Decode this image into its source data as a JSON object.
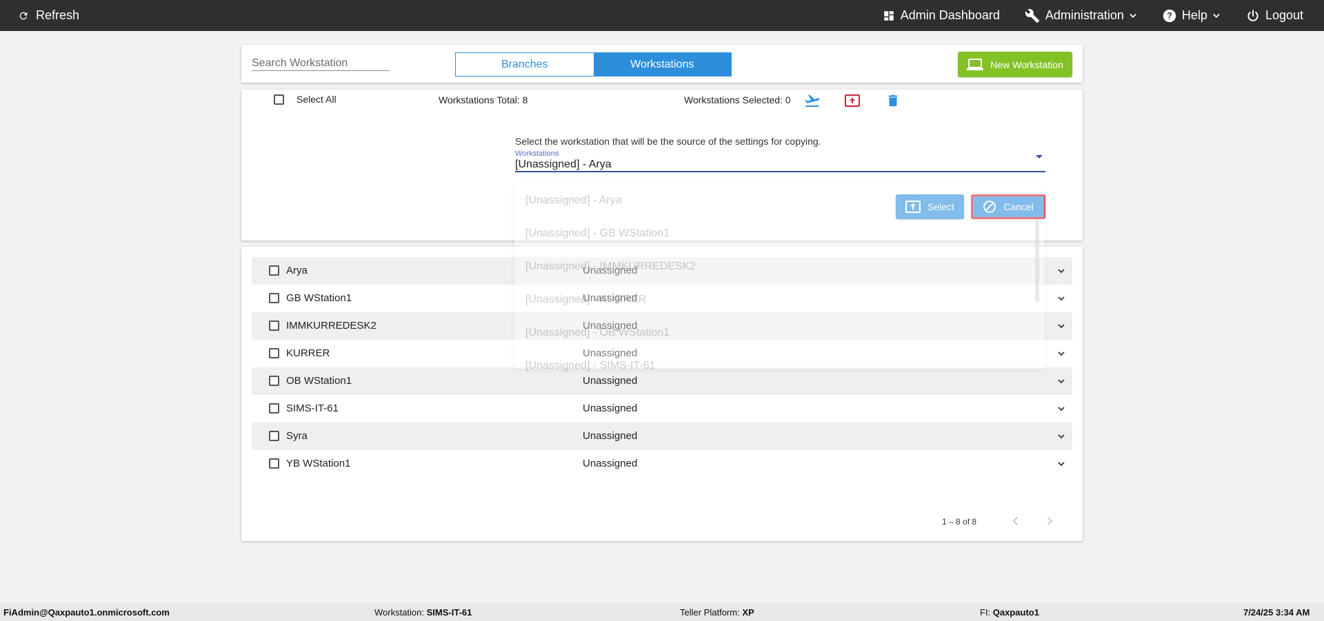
{
  "topbar": {
    "refresh_label": "Refresh",
    "nav": {
      "admin_dashboard": "Admin Dashboard",
      "administration": "Administration",
      "help": "Help",
      "logout": "Logout"
    }
  },
  "toolbar": {
    "search_placeholder": "Search Workstation",
    "tabs": {
      "branches": "Branches",
      "workstations": "Workstations"
    },
    "active_tab": "Workstations",
    "new_workstation_label": "New Workstation"
  },
  "summary": {
    "select_all_label": "Select All",
    "total_text": "Workstations Total: 8",
    "selected_text": "Workstations Selected: 0"
  },
  "copy_settings": {
    "instructions": "Select the workstation that will be the source of the settings for copying.",
    "dropdown_label": "Workstations",
    "dropdown_value": "[Unassigned] - Arya",
    "dropdown_options": [
      "[Unassigned] - Arya",
      "[Unassigned] - GB WStation1",
      "[Unassigned] - IMMKURREDESK2",
      "[Unassigned] - KURRER",
      "[Unassigned] - OB WStation1",
      "[Unassigned] - SIMS-IT-61"
    ],
    "select_label": "Select",
    "cancel_label": "Cancel"
  },
  "workstations": [
    {
      "name": "Arya",
      "branch": "Unassigned"
    },
    {
      "name": "GB WStation1",
      "branch": "Unassigned"
    },
    {
      "name": "IMMKURREDESK2",
      "branch": "Unassigned"
    },
    {
      "name": "KURRER",
      "branch": "Unassigned"
    },
    {
      "name": "OB WStation1",
      "branch": "Unassigned"
    },
    {
      "name": "SIMS-IT-61",
      "branch": "Unassigned"
    },
    {
      "name": "Syra",
      "branch": "Unassigned"
    },
    {
      "name": "YB WStation1",
      "branch": "Unassigned"
    }
  ],
  "pager": {
    "range_text": "1 – 8 of 8"
  },
  "statusbar": {
    "user": "FiAdmin@Qaxpauto1.onmicrosoft.com",
    "workstation_label": "Workstation:",
    "workstation_value": "SIMS-IT-61",
    "platform_label": "Teller Platform:",
    "platform_value": "XP",
    "fi_label": "FI:",
    "fi_value": "Qaxpauto1",
    "datetime": "7/24/25 3:34 AM"
  },
  "colors": {
    "topbar_bg": "#2f2f2f",
    "primary_blue": "#2d8fdc",
    "new_button_green": "#83c226",
    "cancel_highlight": "#e01b2a",
    "delete_icon": "#2d8fdc",
    "export_icon": "#c8243a"
  }
}
